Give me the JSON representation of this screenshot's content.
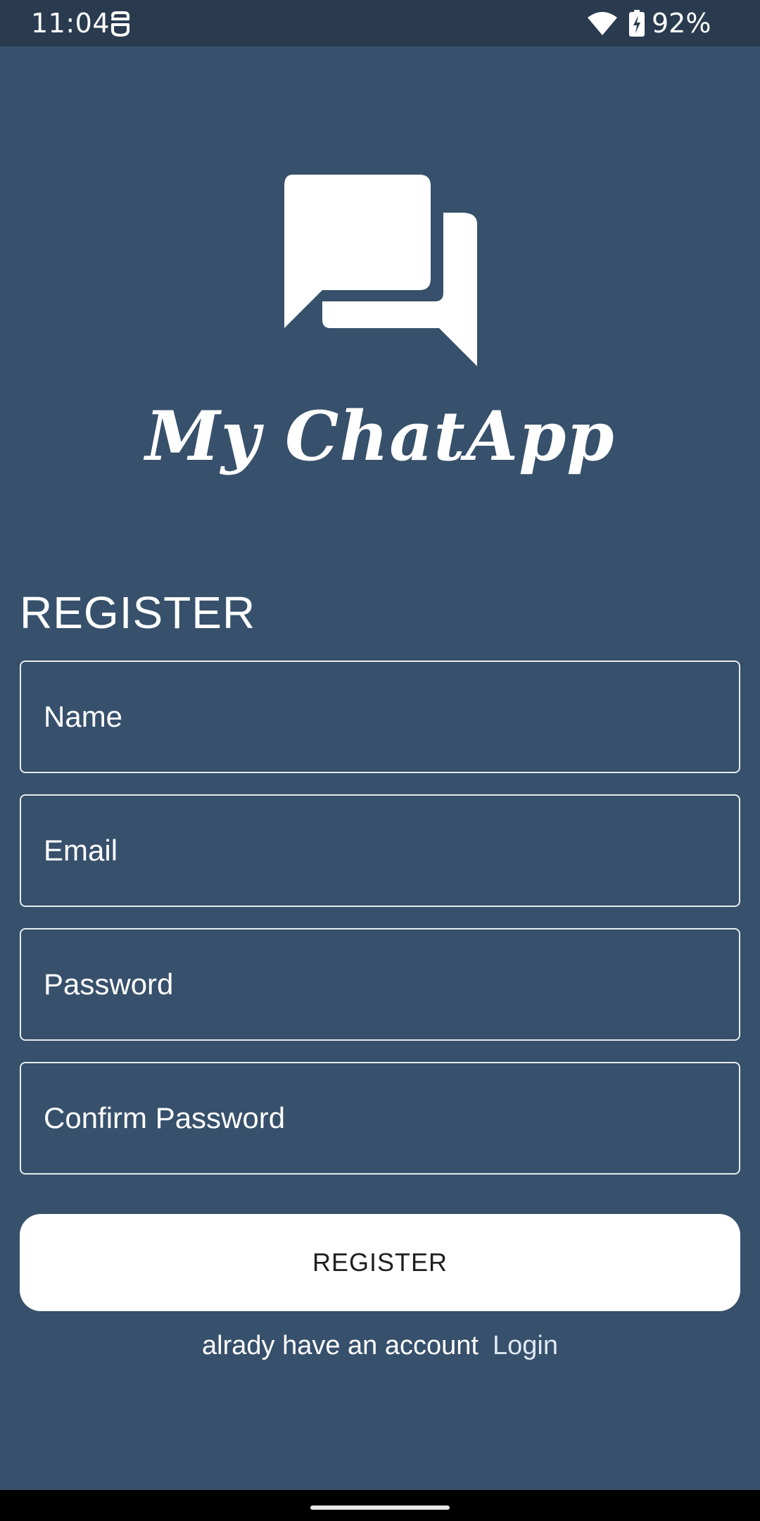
{
  "status_bar": {
    "time": "11:04",
    "battery": "92%",
    "icons": [
      "notification-icon",
      "wifi-icon",
      "battery-charging-icon"
    ]
  },
  "branding": {
    "app_name": "My ChatApp",
    "logo_icon": "chat-bubbles-icon",
    "color": "#ffffff"
  },
  "form": {
    "title": "REGISTER",
    "name_placeholder": "Name",
    "email_placeholder": "Email",
    "password_placeholder": "Password",
    "confirm_password_placeholder": "Confirm Password",
    "submit_label": "REGISTER"
  },
  "footer": {
    "prompt": "alrady have an account",
    "login_label": "Login"
  },
  "colors": {
    "background": "#37506b",
    "status_bar": "#2a3b4f",
    "button_background": "#ffffff",
    "button_text": "#1f1f1f"
  }
}
